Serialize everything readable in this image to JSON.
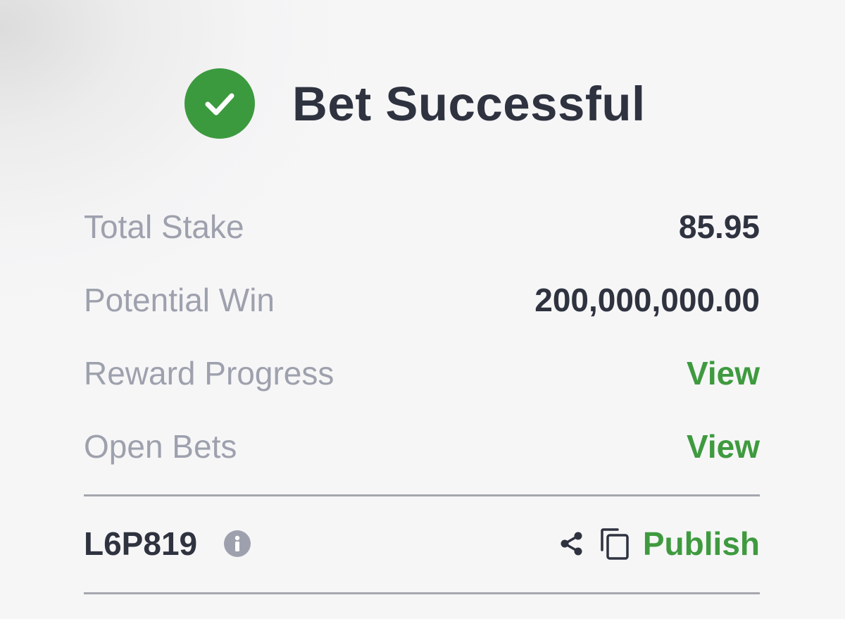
{
  "header": {
    "icon": "check-circle-icon",
    "title": "Bet Successful",
    "accent_color": "#3c9a3e"
  },
  "summary": {
    "rows": [
      {
        "label": "Total Stake",
        "value": "85.95"
      },
      {
        "label": "Potential Win",
        "value": "200,000,000.00"
      },
      {
        "label": "Reward Progress",
        "value": "View"
      },
      {
        "label": "Open Bets",
        "value": "View"
      }
    ]
  },
  "footer": {
    "booking_code": "L6P819",
    "info_icon": "info-icon",
    "share_icon": "share-icon",
    "copy_icon": "copy-icon",
    "publish_label": "Publish"
  }
}
